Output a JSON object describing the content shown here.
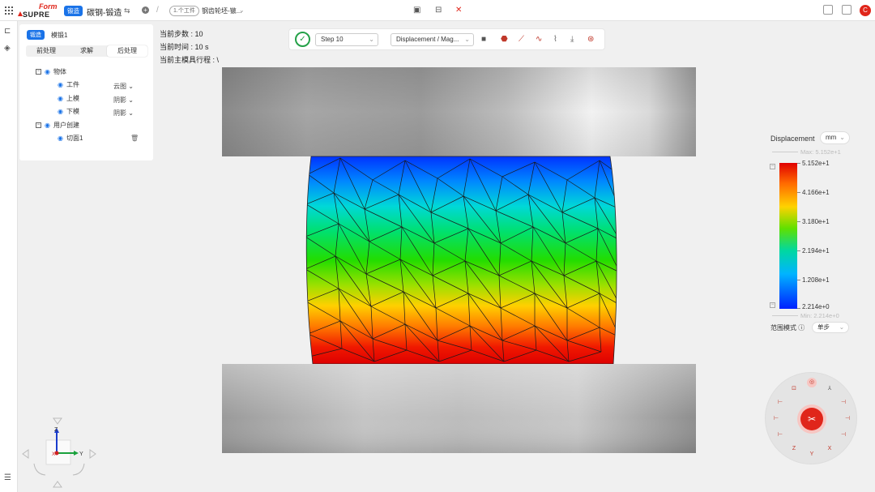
{
  "header": {
    "logo_top": "Form",
    "logo_bottom": "SUPRE",
    "mode_badge": "锻造",
    "project_title": "碳钢-锻造",
    "version_pill": "1.个工件",
    "file_name": "钢齿轮坯-镦..."
  },
  "avatar_letter": "C",
  "panel": {
    "model_tag": "锻造",
    "model_name": "模锻1",
    "tabs": [
      "前处理",
      "求解",
      "后处理"
    ],
    "active_tab": 2,
    "tree": {
      "bodies_label": "物体",
      "workpiece_label": "工件",
      "workpiece_mode": "云图",
      "upper_die_label": "上模",
      "upper_die_mode": "阴影",
      "lower_die_label": "下模",
      "lower_die_mode": "阴影",
      "user_created_label": "用户创建",
      "section_label": "切面1"
    }
  },
  "info": {
    "step_text": "当前步数 : 10",
    "time_text": "当前时间 : 10 s",
    "stroke_text": "当前主模具行程 : \\"
  },
  "toolbar": {
    "step_select": "Step 10",
    "result_select": "Displacement / Mag..."
  },
  "legend": {
    "title": "Displacement",
    "unit": "mm",
    "max_text": "Max: 5.152e+1",
    "min_text": "Min: 2.214e+0",
    "ticks": [
      "5.152e+1",
      "4.166e+1",
      "3.180e+1",
      "2.194e+1",
      "1.208e+1",
      "2.214e+0"
    ],
    "range_label": "范围模式",
    "range_value": "单步"
  },
  "view_dial": {
    "x_label": "X",
    "y_label": "Y",
    "z_label": "Z"
  },
  "colors": {
    "accent": "#1a73e8",
    "brand_red": "#e0261b",
    "ok_green": "#24a148"
  }
}
